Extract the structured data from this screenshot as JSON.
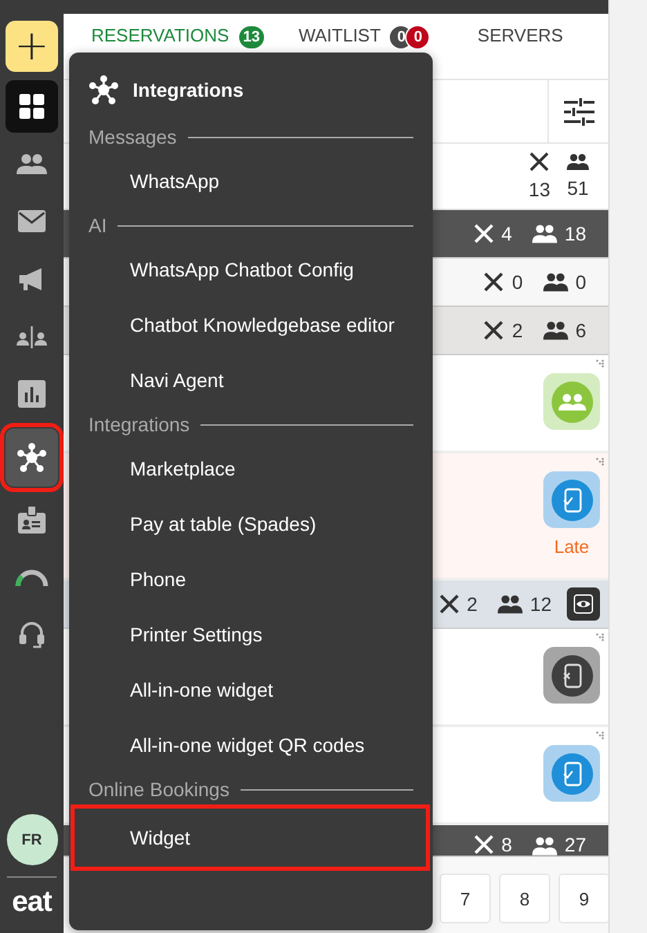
{
  "sidebar": {
    "add_button": "+",
    "items": [
      {
        "kind": "grid",
        "selected": true,
        "highlighted": false
      },
      {
        "kind": "people",
        "selected": false,
        "highlighted": false
      },
      {
        "kind": "mail",
        "selected": false,
        "highlighted": false
      },
      {
        "kind": "megaphone",
        "selected": false,
        "highlighted": false
      },
      {
        "kind": "split",
        "selected": false,
        "highlighted": false
      },
      {
        "kind": "chart",
        "selected": false,
        "highlighted": false
      },
      {
        "kind": "hub",
        "selected": false,
        "highlighted": true
      },
      {
        "kind": "badge",
        "selected": false,
        "highlighted": false
      },
      {
        "kind": "gauge",
        "selected": false,
        "highlighted": false
      },
      {
        "kind": "headset",
        "selected": false,
        "highlighted": false
      }
    ],
    "avatar": "FR",
    "logo": "eat"
  },
  "tabs": [
    {
      "label": "RESERVATIONS",
      "selected": true,
      "badges": [
        {
          "text": "13",
          "color": "#1e8a3c"
        }
      ]
    },
    {
      "label": "WAITLIST",
      "selected": false,
      "badges": [
        {
          "text": "0",
          "color": "#4a4a4a"
        },
        {
          "text": "0",
          "color": "#c0061b"
        }
      ]
    },
    {
      "label": "SERVERS",
      "selected": false
    }
  ],
  "rows": [
    {
      "kind": "totals",
      "tables": "13",
      "guests": "51"
    },
    {
      "kind": "section",
      "color": "#545454",
      "tables": "4",
      "guests": "18",
      "eye_button": false
    },
    {
      "kind": "section",
      "color": "#f7f7f7",
      "tables": "0",
      "guests": "0",
      "eye_button": false
    },
    {
      "kind": "section",
      "color": "#e6e3e3",
      "tables": "2",
      "guests": "6",
      "eye_button": false
    },
    {
      "kind": "card",
      "status_icon": {
        "kind": "seated"
      },
      "color": "#ffffff"
    },
    {
      "kind": "card",
      "status_icon": {
        "kind": "confirmed"
      },
      "color": "#fff5f3",
      "note": "Late"
    },
    {
      "kind": "section",
      "color": "#dde2e8",
      "tables": "2",
      "guests": "12",
      "eye_button": true
    },
    {
      "kind": "card",
      "status_icon": {
        "kind": "cancelled"
      },
      "color": "#ffffff"
    },
    {
      "kind": "card",
      "status_icon": {
        "kind": "confirmed"
      },
      "color": "#ffffff"
    },
    {
      "kind": "section",
      "color": "#545454",
      "tables": "8",
      "guests": "27",
      "eye_button": false
    }
  ],
  "keypad": [
    "7",
    "8",
    "9"
  ],
  "menu": {
    "title": "Integrations",
    "sections": [
      {
        "heading": "Messages",
        "items": [
          {
            "label": "WhatsApp",
            "highlighted": false
          }
        ]
      },
      {
        "heading": "AI",
        "items": [
          {
            "label": "WhatsApp Chatbot Config",
            "highlighted": false
          },
          {
            "label": "Chatbot Knowledgebase editor",
            "highlighted": false
          },
          {
            "label": "Navi Agent",
            "highlighted": false
          }
        ]
      },
      {
        "heading": "Integrations",
        "items": [
          {
            "label": "Marketplace",
            "highlighted": false
          },
          {
            "label": "Pay at table (Spades)",
            "highlighted": false
          },
          {
            "label": "Phone",
            "highlighted": false
          },
          {
            "label": "Printer Settings",
            "highlighted": false
          },
          {
            "label": "All-in-one widget",
            "highlighted": false
          },
          {
            "label": "All-in-one widget QR codes",
            "highlighted": false
          }
        ]
      },
      {
        "heading": "Online Bookings",
        "items": [
          {
            "label": "Widget",
            "highlighted": true
          }
        ]
      }
    ]
  }
}
